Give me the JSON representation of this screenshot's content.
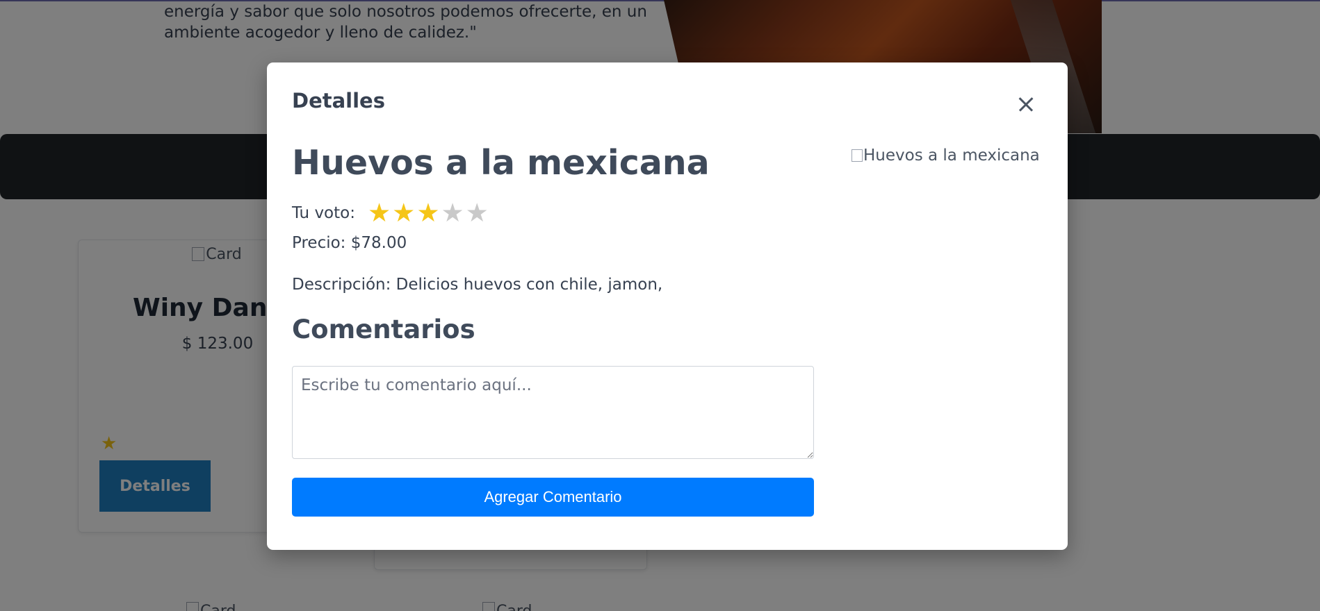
{
  "background": {
    "hero_text": "energía y sabor que solo nosotros podemos ofrecerte, en un ambiente acogedor y lleno de calidez.\"",
    "cards": [
      {
        "image_alt": "Card",
        "title": "Winy Daniel",
        "price": "$ 123.00",
        "rating_star": "★",
        "button_label": "Detalles"
      }
    ],
    "bottom_alts": [
      "Card",
      "Card"
    ]
  },
  "modal": {
    "title": "Detalles",
    "dish": {
      "name": "Huevos a la mexicana",
      "image_alt": "Huevos a la mexicana",
      "vote_label": "Tu voto:",
      "rating": 3,
      "rating_max": 5,
      "price_line": "Precio: $78.00",
      "description_line": "Descripción: Delicios huevos con chile, jamon,"
    },
    "comments": {
      "heading": "Comentarios",
      "placeholder": "Escribe tu comentario aquí...",
      "value": "",
      "button_label": "Agregar Comentario"
    }
  },
  "colors": {
    "accent": "#007bff",
    "star_on": "#f5c518",
    "star_off": "#c9c9c9",
    "overlay": "rgba(0,0,0,0.5)"
  },
  "icons": {
    "close": "close-icon",
    "star": "star-icon"
  }
}
